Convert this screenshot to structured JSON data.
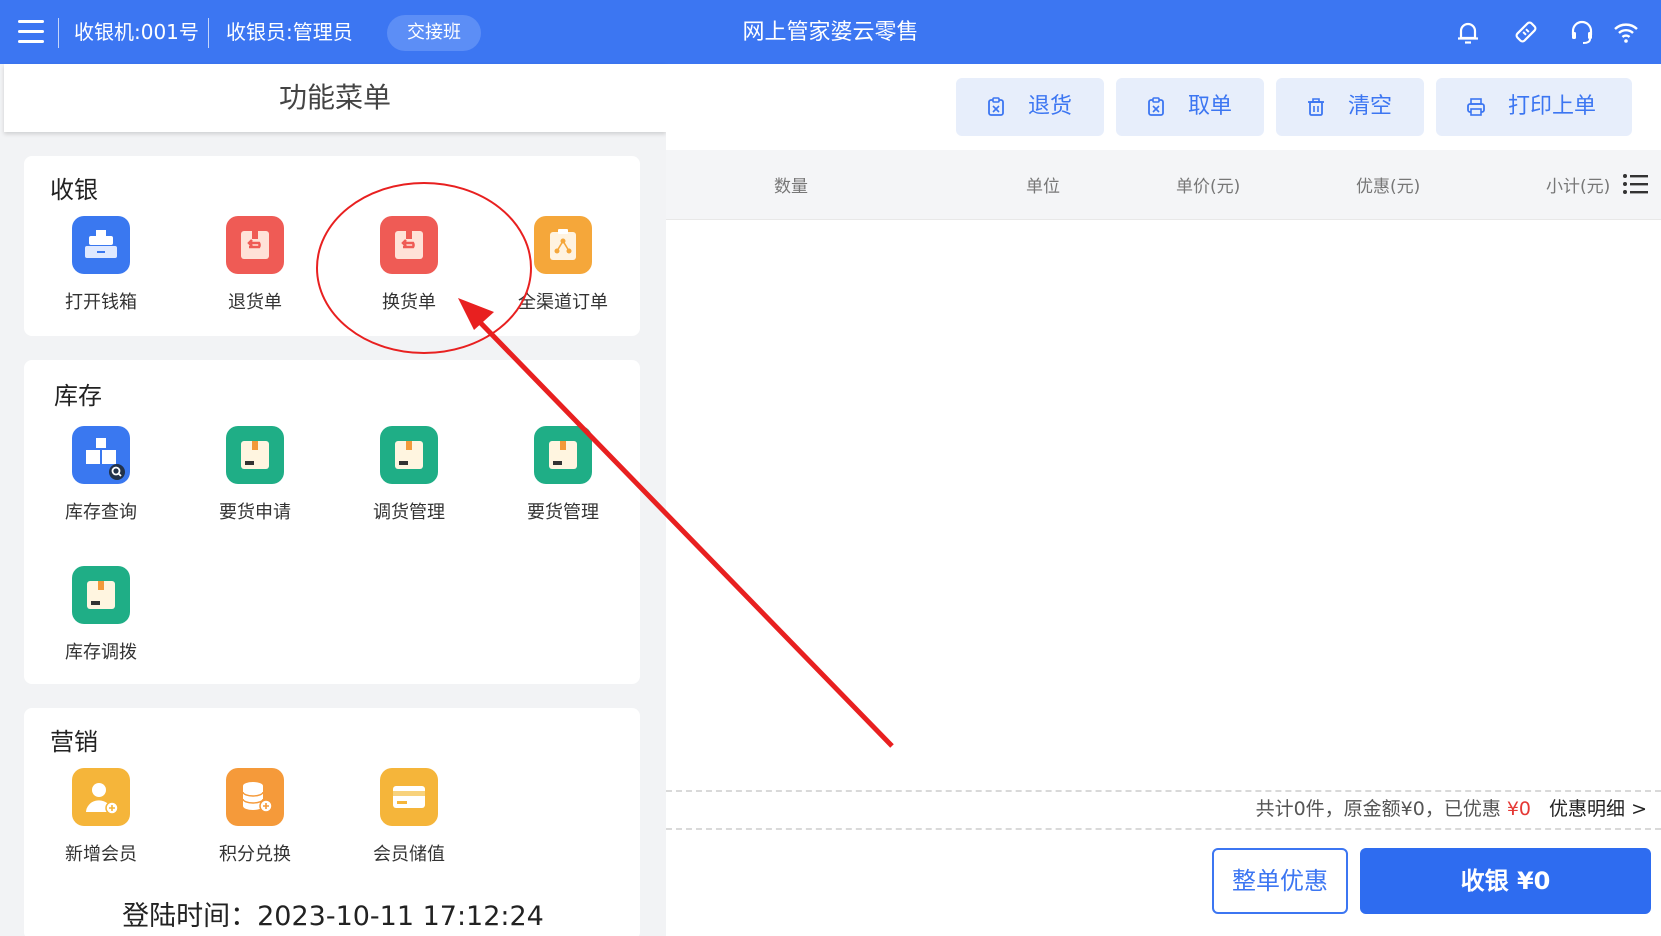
{
  "topbar": {
    "cashier_no": "收银机:001号",
    "cashier_user": "收银员:管理员",
    "shift_button": "交接班",
    "title": "网上管家婆云零售",
    "icons": [
      "menu-icon",
      "bell-icon",
      "tag-icon",
      "headset-icon",
      "wifi-icon"
    ]
  },
  "menu": {
    "header": "功能菜单",
    "sections": [
      {
        "title": "收银",
        "items": [
          {
            "label": "打开钱箱",
            "icon": "cash-drawer-icon",
            "color": "#3a78f0"
          },
          {
            "label": "退货单",
            "icon": "return-order-icon",
            "color": "#ef5b55"
          },
          {
            "label": "换货单",
            "icon": "exchange-order-icon",
            "color": "#ef5b55"
          },
          {
            "label": "全渠道订单",
            "icon": "omnichannel-order-icon",
            "color": "#f5a73a"
          }
        ]
      },
      {
        "title": "库存",
        "items": [
          {
            "label": "库存查询",
            "icon": "stock-query-icon",
            "color": "#3a78f0"
          },
          {
            "label": "要货申请",
            "icon": "request-goods-icon",
            "color": "#1fae86"
          },
          {
            "label": "调货管理",
            "icon": "transfer-manage-icon",
            "color": "#1fae86"
          },
          {
            "label": "要货管理",
            "icon": "request-manage-icon",
            "color": "#1fae86"
          },
          {
            "label": "库存调拨",
            "icon": "stock-allocate-icon",
            "color": "#1fae86"
          }
        ]
      },
      {
        "title": "营销",
        "items": [
          {
            "label": "新增会员",
            "icon": "add-member-icon",
            "color": "#f5b53a"
          },
          {
            "label": "积分兑换",
            "icon": "points-exchange-icon",
            "color": "#f59a3a"
          },
          {
            "label": "会员储值",
            "icon": "member-stored-value-icon",
            "color": "#f5b53a"
          }
        ]
      }
    ]
  },
  "login_time": "登陆时间：2023-10-11 17:12:24",
  "actions": [
    {
      "label": "退货",
      "icon": "return-icon"
    },
    {
      "label": "取单",
      "icon": "retrieve-order-icon"
    },
    {
      "label": "清空",
      "icon": "trash-icon"
    },
    {
      "label": "打印上单",
      "icon": "printer-icon"
    }
  ],
  "table": {
    "columns": [
      "数量",
      "单位",
      "单价(元)",
      "优惠(元)",
      "小计(元)"
    ],
    "rows": []
  },
  "summary": {
    "text": "共计0件，原金额¥0，已优惠",
    "discount": "¥0",
    "detail_link": "优惠明细 >"
  },
  "footer": {
    "discount_button": "整单优惠",
    "pay_button": "收银 ¥0"
  },
  "annotation": {
    "color": "#e82020"
  },
  "colors": {
    "primary": "#3c76f2",
    "danger": "#e53935"
  }
}
